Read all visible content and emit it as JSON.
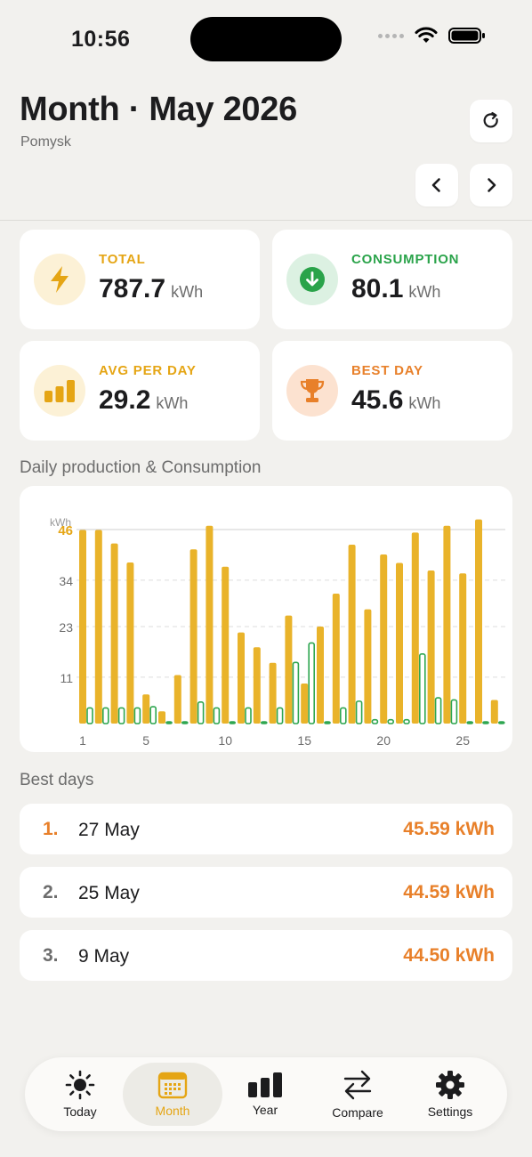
{
  "status": {
    "time": "10:56"
  },
  "header": {
    "title": "Month · May 2026",
    "location": "Pomysk"
  },
  "stats": {
    "total": {
      "label": "TOTAL",
      "value": "787.7",
      "unit": "kWh",
      "color": "#e5a514",
      "icon": "lightning-icon"
    },
    "consumption": {
      "label": "CONSUMPTION",
      "value": "80.1",
      "unit": "kWh",
      "color": "#2aa34a",
      "icon": "arrow-down-circle-icon"
    },
    "avg": {
      "label": "AVG PER DAY",
      "value": "29.2",
      "unit": "kWh",
      "color": "#e5a514",
      "icon": "bar-chart-icon"
    },
    "best": {
      "label": "BEST DAY",
      "value": "45.6",
      "unit": "kWh",
      "color": "#e8802a",
      "icon": "trophy-icon"
    }
  },
  "chart_section_title": "Daily production & Consumption",
  "chart_data": {
    "type": "bar",
    "title": "",
    "ylabel": "kWh",
    "ylim": [
      0,
      46
    ],
    "yticks": [
      11,
      23,
      34,
      46
    ],
    "xticks": [
      1,
      5,
      10,
      15,
      20,
      25
    ],
    "x": [
      1,
      2,
      3,
      4,
      5,
      6,
      7,
      8,
      9,
      10,
      11,
      12,
      13,
      14,
      15,
      16,
      17,
      18,
      19,
      20,
      21,
      22,
      23,
      24,
      25,
      26,
      27,
      28
    ],
    "series": [
      {
        "color": "#e9b32a",
        "values": [
          45.9,
          45.9,
          42.7,
          38.2,
          6.9,
          2.9,
          11.5,
          41.3,
          46.9,
          37.2,
          21.6,
          18.1,
          14.4,
          25.6,
          9.5,
          23.0,
          30.8,
          42.4,
          27.1,
          40.1,
          38.1,
          45.3,
          36.3,
          46.9,
          35.6,
          48.4,
          5.6,
          0
        ]
      },
      {
        "color": "#2ea650",
        "values": [
          3.7,
          3.7,
          3.7,
          3.7,
          4.0,
          0.3,
          0.3,
          5.1,
          3.7,
          0.3,
          3.7,
          0.3,
          3.7,
          14.5,
          19.1,
          0.3,
          3.7,
          5.3,
          0.9,
          0.9,
          0.9,
          16.5,
          6.1,
          5.6,
          0.3,
          0.3,
          0.3,
          0.3
        ]
      }
    ]
  },
  "best_days": {
    "title": "Best days",
    "items": [
      {
        "rank": "1.",
        "date": "27 May",
        "kwh": "45.59 kWh"
      },
      {
        "rank": "2.",
        "date": "25 May",
        "kwh": "44.59 kWh"
      },
      {
        "rank": "3.",
        "date": "9 May",
        "kwh": "44.50 kWh"
      }
    ]
  },
  "tabs": [
    {
      "label": "Today",
      "icon": "sun-icon"
    },
    {
      "label": "Month",
      "icon": "calendar-icon"
    },
    {
      "label": "Year",
      "icon": "bar-chart-icon"
    },
    {
      "label": "Compare",
      "icon": "arrows-swap-icon"
    },
    {
      "label": "Settings",
      "icon": "gear-icon"
    }
  ],
  "colors": {
    "accent": "#e5a514",
    "orange": "#e8802a",
    "green": "#2aa34a",
    "bg": "#f2f1ee"
  }
}
